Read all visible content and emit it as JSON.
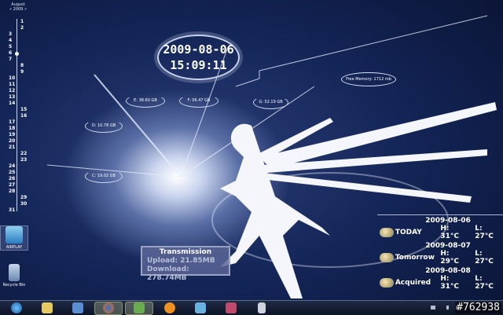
{
  "calendar": {
    "month": "August",
    "year_nav": "« 2009 »",
    "today": 6,
    "days": [
      1,
      2,
      3,
      4,
      5,
      6,
      7,
      8,
      9,
      10,
      11,
      12,
      13,
      14,
      15,
      16,
      17,
      18,
      19,
      20,
      21,
      22,
      23,
      24,
      25,
      26,
      27,
      28,
      29,
      30,
      31
    ]
  },
  "clock": {
    "date": "2009-08-06",
    "time": "15:09:11"
  },
  "drives": [
    {
      "label": "E: 38.60 GB"
    },
    {
      "label": "F: 06.47 GB"
    },
    {
      "label": "G: 52.19 GB"
    },
    {
      "label": "D: 10.78 GB"
    },
    {
      "label": "C: 19.02 GB"
    }
  ],
  "memory": "Free Memory: 1712 mb",
  "transmission": {
    "title": "Transmission",
    "upload": "Upload: 21.85MB",
    "download": "Download: 278.74MB"
  },
  "weather": [
    {
      "date": "2009-08-06",
      "name": "TODAY",
      "high": "H: 31°C",
      "low": "L: 27°C",
      "icon": "rain-cloud-icon"
    },
    {
      "date": "2009-08-07",
      "name": "Tomorrow",
      "high": "H: 29°C",
      "low": "L: 27°C",
      "icon": "partly-sunny-icon"
    },
    {
      "date": "2009-08-08",
      "name": "Acquired",
      "high": "H: 31°C",
      "low": "L: 27°C",
      "icon": "partly-sunny-icon"
    }
  ],
  "desktop_icons": [
    {
      "label": "AIRPLAY"
    },
    {
      "label": "Recycle Bin"
    }
  ],
  "taskbar": [
    "start",
    "explorer",
    "media-player",
    "firefox",
    "messenger",
    "vlc",
    "itunes",
    "app",
    "calculator"
  ],
  "watermark": "#762938"
}
